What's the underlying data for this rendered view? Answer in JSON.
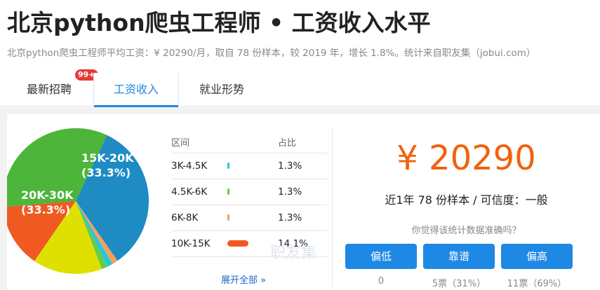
{
  "page": {
    "title": "北京python爬虫工程师 • 工资收入水平",
    "subtitle": "北京python爬虫工程师平均工资：¥ 20290/月，取自 78 份样本，较 2019 年，增长 1.8%。统计来自职友集（jobui.com）"
  },
  "tabs": [
    {
      "label": "最新招聘",
      "badge": "99+"
    },
    {
      "label": "工资收入"
    },
    {
      "label": "就业形势"
    }
  ],
  "table": {
    "col_range": "区间",
    "col_ratio": "占比",
    "rows": [
      {
        "range": "3K-4.5K",
        "ratio": "1.3%",
        "color": "#26c6da",
        "value": 1.3
      },
      {
        "range": "4.5K-6K",
        "ratio": "1.3%",
        "color": "#66cc44",
        "value": 1.3
      },
      {
        "range": "6K-8K",
        "ratio": "1.3%",
        "color": "#f5a05a",
        "value": 1.3
      },
      {
        "range": "10K-15K",
        "ratio": "14.1%",
        "color": "#f05a22",
        "value": 14.1
      }
    ],
    "more_label": "展开全部 »"
  },
  "watermark": "职友集",
  "summary": {
    "salary": "¥ 20290",
    "samples": "近1年 78 份样本 / 可信度：一般",
    "question": "你觉得该统计数据准确吗？"
  },
  "votes": [
    {
      "label": "偏低",
      "count": "0"
    },
    {
      "label": "靠谱",
      "count": "5票（31%）"
    },
    {
      "label": "偏高",
      "count": "11票（69%）"
    }
  ],
  "chart_data": {
    "type": "pie",
    "slices": [
      {
        "label": "15K-20K",
        "text": "(33.3%)",
        "value": 33.3,
        "color": "#1e8bc3"
      },
      {
        "label": "",
        "text": "",
        "value": 1.3,
        "color": "#f5a05a"
      },
      {
        "label": "",
        "text": "",
        "value": 1.3,
        "color": "#26c6da"
      },
      {
        "label": "",
        "text": "",
        "value": 1.3,
        "color": "#66cc44"
      },
      {
        "label": "",
        "text": "",
        "value": 15.4,
        "color": "#e0e000"
      },
      {
        "label": "",
        "text": "",
        "value": 14.1,
        "color": "#f05a22"
      },
      {
        "label": "20K-30K",
        "text": "(33.3%)",
        "value": 33.3,
        "color": "#4db53a"
      }
    ]
  }
}
